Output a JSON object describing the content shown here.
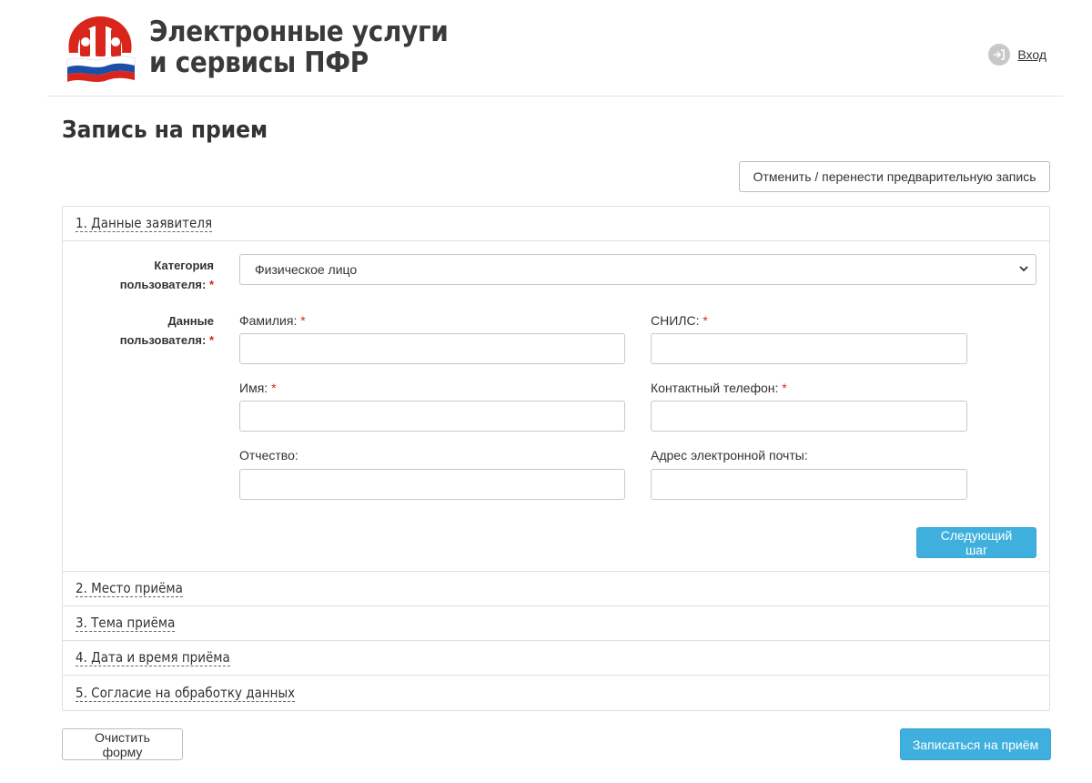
{
  "header": {
    "title_line1": "Электронные услуги",
    "title_line2": "и сервисы ПФР",
    "login_label": "Вход"
  },
  "page": {
    "title": "Запись на прием"
  },
  "actions": {
    "cancel_label": "Отменить / перенести предварительную запись",
    "clear_label": "Очистить форму",
    "submit_label": "Записаться на приём",
    "next_label": "Следующий шаг"
  },
  "steps": [
    {
      "label": "1. Данные заявителя"
    },
    {
      "label": "2. Место приёма"
    },
    {
      "label": "3. Тема приёма"
    },
    {
      "label": "4. Дата и время приёма"
    },
    {
      "label": "5. Согласие на обработку данных"
    }
  ],
  "form": {
    "category_label_1": "Категория",
    "category_label_2": "пользователя:",
    "category_value": "Физическое лицо",
    "user_label_1": "Данные",
    "user_label_2": "пользователя:",
    "required_mark": "*",
    "fields": {
      "lastname": "Фамилия:",
      "firstname": "Имя:",
      "patronymic": "Отчество:",
      "snils": "СНИЛС:",
      "phone": "Контактный телефон:",
      "email": "Адрес электронной почты:"
    }
  },
  "colors": {
    "primary": "#3fb0de",
    "required": "#d9261c",
    "logo_red": "#d9261c"
  }
}
